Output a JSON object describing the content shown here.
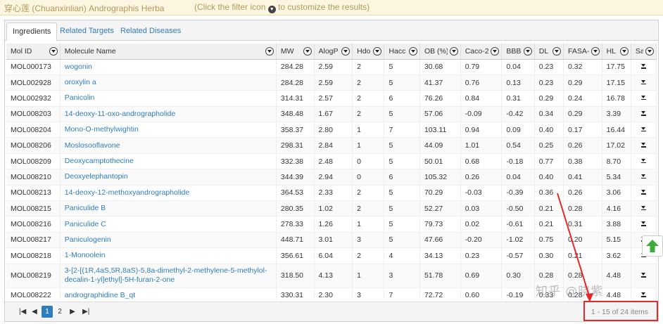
{
  "banner": {
    "title": "穿心莲 (Chuanxinlian) Andrographis Herba",
    "hint_before": "(Click the filter icon",
    "hint_icon": "filter-icon",
    "hint_after": "to customize the results)"
  },
  "tabs": [
    {
      "label": "Ingredients",
      "active": true
    },
    {
      "label": "Related Targets",
      "active": false
    },
    {
      "label": "Related Diseases",
      "active": false
    }
  ],
  "table": {
    "columns": [
      "Mol ID",
      "Molecule Name",
      "MW",
      "AlogP",
      "Hdon",
      "Hacc",
      "OB (%)",
      "Caco-2",
      "BBB",
      "DL",
      "FASA-",
      "HL",
      "Save"
    ],
    "rows": [
      {
        "mol_id": "MOL000173",
        "name": "wogonin",
        "mw": "284.28",
        "alogp": "2.59",
        "hdon": "2",
        "hacc": "5",
        "ob": "30.68",
        "caco2": "0.79",
        "bbb": "0.04",
        "dl": "0.23",
        "fasa": "0.32",
        "hl": "17.75"
      },
      {
        "mol_id": "MOL002928",
        "name": "oroxylin a",
        "mw": "284.28",
        "alogp": "2.59",
        "hdon": "2",
        "hacc": "5",
        "ob": "41.37",
        "caco2": "0.76",
        "bbb": "0.13",
        "dl": "0.23",
        "fasa": "0.29",
        "hl": "17.15"
      },
      {
        "mol_id": "MOL002932",
        "name": "Panicolin",
        "mw": "314.31",
        "alogp": "2.57",
        "hdon": "2",
        "hacc": "6",
        "ob": "76.26",
        "caco2": "0.84",
        "bbb": "0.31",
        "dl": "0.29",
        "fasa": "0.24",
        "hl": "16.78"
      },
      {
        "mol_id": "MOL008203",
        "name": "14-deoxy-11-oxo-andrographolide",
        "mw": "348.48",
        "alogp": "1.67",
        "hdon": "2",
        "hacc": "5",
        "ob": "57.06",
        "caco2": "-0.09",
        "bbb": "-0.42",
        "dl": "0.34",
        "fasa": "0.29",
        "hl": "3.39"
      },
      {
        "mol_id": "MOL008204",
        "name": "Mono-O-methylwightin",
        "mw": "358.37",
        "alogp": "2.80",
        "hdon": "1",
        "hacc": "7",
        "ob": "103.11",
        "caco2": "0.94",
        "bbb": "0.09",
        "dl": "0.40",
        "fasa": "0.17",
        "hl": "16.44"
      },
      {
        "mol_id": "MOL008206",
        "name": "Moslosooflavone",
        "mw": "298.31",
        "alogp": "2.84",
        "hdon": "1",
        "hacc": "5",
        "ob": "44.09",
        "caco2": "1.01",
        "bbb": "0.54",
        "dl": "0.25",
        "fasa": "0.26",
        "hl": "17.02"
      },
      {
        "mol_id": "MOL008209",
        "name": "Deoxycamptothecine",
        "mw": "332.38",
        "alogp": "2.48",
        "hdon": "0",
        "hacc": "5",
        "ob": "50.01",
        "caco2": "0.68",
        "bbb": "-0.18",
        "dl": "0.77",
        "fasa": "0.38",
        "hl": "8.70"
      },
      {
        "mol_id": "MOL008210",
        "name": "Deoxyelephantopin",
        "mw": "344.39",
        "alogp": "2.94",
        "hdon": "0",
        "hacc": "6",
        "ob": "105.32",
        "caco2": "0.26",
        "bbb": "0.04",
        "dl": "0.40",
        "fasa": "0.41",
        "hl": "5.34"
      },
      {
        "mol_id": "MOL008213",
        "name": "14-deoxy-12-methoxyandrographolide",
        "mw": "364.53",
        "alogp": "2.33",
        "hdon": "2",
        "hacc": "5",
        "ob": "70.29",
        "caco2": "-0.03",
        "bbb": "-0.39",
        "dl": "0.36",
        "fasa": "0.26",
        "hl": "3.06"
      },
      {
        "mol_id": "MOL008215",
        "name": "Paniculide B",
        "mw": "280.35",
        "alogp": "1.02",
        "hdon": "2",
        "hacc": "5",
        "ob": "52.27",
        "caco2": "0.03",
        "bbb": "-0.50",
        "dl": "0.21",
        "fasa": "0.28",
        "hl": "4.16"
      },
      {
        "mol_id": "MOL008216",
        "name": "Paniculide C",
        "mw": "278.33",
        "alogp": "1.26",
        "hdon": "1",
        "hacc": "5",
        "ob": "79.73",
        "caco2": "0.02",
        "bbb": "-0.61",
        "dl": "0.21",
        "fasa": "0.31",
        "hl": "3.88"
      },
      {
        "mol_id": "MOL008217",
        "name": "Paniculogenin",
        "mw": "448.71",
        "alogp": "3.01",
        "hdon": "3",
        "hacc": "5",
        "ob": "47.66",
        "caco2": "-0.20",
        "bbb": "-1.02",
        "dl": "0.75",
        "fasa": "0.20",
        "hl": "5.15"
      },
      {
        "mol_id": "MOL008218",
        "name": "1-Monoolein",
        "mw": "356.61",
        "alogp": "6.04",
        "hdon": "2",
        "hacc": "4",
        "ob": "34.13",
        "caco2": "0.23",
        "bbb": "-0.57",
        "dl": "0.30",
        "fasa": "0.21",
        "hl": "3.62"
      },
      {
        "mol_id": "MOL008219",
        "name": "3-[2-[(1R,4aS,5R,8aS)-5,8a-dimethyl-2-methylene-5-methylol-decalin-1-yl]ethyl]-5H-furan-2-one",
        "mw": "318.50",
        "alogp": "4.13",
        "hdon": "1",
        "hacc": "3",
        "ob": "51.78",
        "caco2": "0.69",
        "bbb": "0.30",
        "dl": "0.28",
        "fasa": "0.28",
        "hl": "4.48",
        "tall": true
      },
      {
        "mol_id": "MOL008222",
        "name": "andrographidine B_qt",
        "mw": "330.31",
        "alogp": "2.30",
        "hdon": "3",
        "hacc": "7",
        "ob": "72.72",
        "caco2": "0.60",
        "bbb": "-0.19",
        "dl": "0.33",
        "fasa": "0.28",
        "hl": "4.48"
      }
    ]
  },
  "pager": {
    "first": "|◀",
    "prev": "◀",
    "pages": [
      "1",
      "2"
    ],
    "current": "1",
    "next": "▶",
    "last": "▶|",
    "info": "1 - 15 of 24 items"
  },
  "watermark": "知乎 @晓紫",
  "colors": {
    "link": "#2e7ebd",
    "banner_bg": "#fcf5e0",
    "highlight": "#e32a2a",
    "scroll_top": "#3bab3b"
  }
}
